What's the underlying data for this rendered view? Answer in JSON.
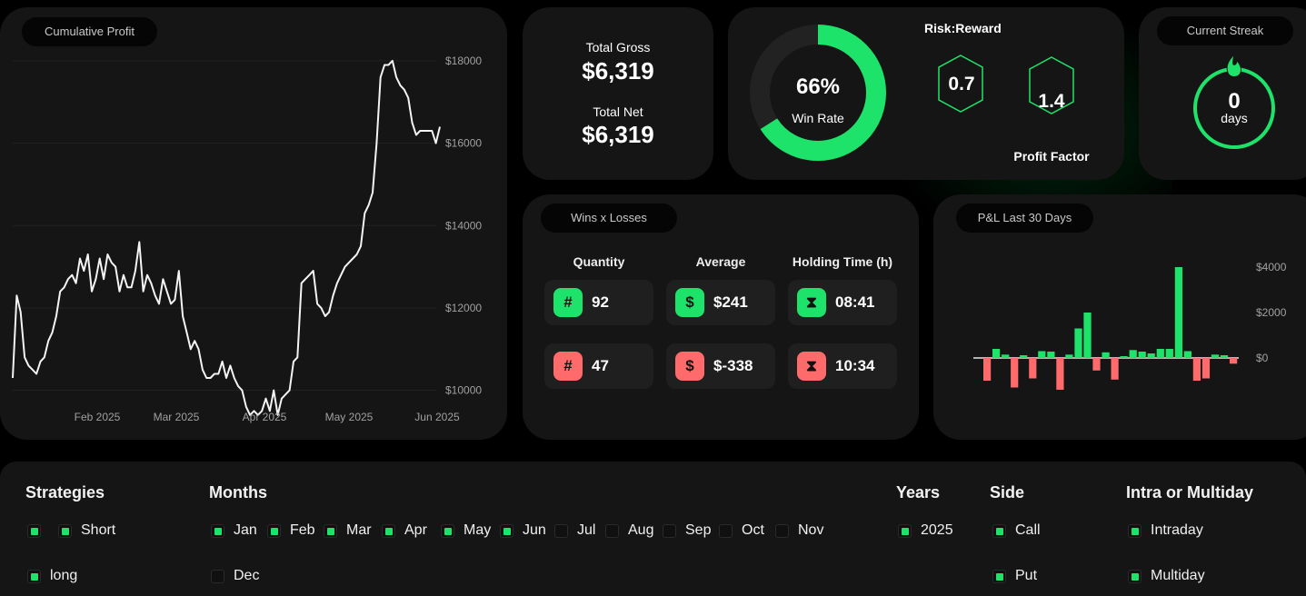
{
  "colors": {
    "accent": "#1ee36a",
    "negative": "#ff6b6b",
    "card": "#151515"
  },
  "cumulative": {
    "title": "Cumulative Profit",
    "chart_data": {
      "type": "line",
      "title": "",
      "y_ticks": [
        "$18000",
        "$16000",
        "$14000",
        "$12000",
        "$10000"
      ],
      "x_ticks": [
        "Feb 2025",
        "Mar 2025",
        "Apr 2025",
        "May 2025",
        "Jun 2025"
      ],
      "ylim": [
        8800,
        19300
      ],
      "grid": true,
      "series": [
        {
          "values": [
            10300,
            12300,
            11900,
            10800,
            10600,
            10500,
            10400,
            10700,
            10800,
            11200,
            11400,
            11800,
            12400,
            12500,
            12700,
            12800,
            12600,
            13200,
            12900,
            13300,
            12400,
            12700,
            13200,
            12700,
            13300,
            13100,
            13000,
            12400,
            12800,
            12500,
            12500,
            12900,
            13600,
            12400,
            12800,
            12600,
            12300,
            12100,
            12700,
            12400,
            12100,
            12200,
            12900,
            11800,
            11400,
            11000,
            11200,
            11000,
            10500,
            10300,
            10300,
            10400,
            10400,
            10700,
            10300,
            10600,
            10300,
            10100,
            10000,
            9600,
            9400,
            9500,
            9400,
            9500,
            9800,
            9500,
            10000,
            9400,
            9800,
            9900,
            10000,
            10700,
            10800,
            12600,
            12700,
            12800,
            12900,
            12100,
            12000,
            11800,
            11900,
            12300,
            12600,
            12800,
            13000,
            13100,
            13200,
            13300,
            13500,
            14300,
            14500,
            14800,
            16000,
            17600,
            17900,
            17900,
            18000,
            17600,
            17400,
            17300,
            17100,
            16500,
            16200,
            16300,
            16300,
            16300,
            16300,
            16000,
            16400
          ]
        }
      ]
    }
  },
  "gross": {
    "label": "Total Gross",
    "value": "$6,319"
  },
  "net": {
    "label": "Total Net",
    "value": "$6,319"
  },
  "winrate": {
    "value": "66%",
    "label": "Win Rate",
    "percent": 66
  },
  "risk": {
    "label": "Risk:Reward",
    "value": "0.7"
  },
  "profit_factor": {
    "label": "Profit Factor",
    "value": "1.4"
  },
  "streak": {
    "label": "Current Streak",
    "value": "0",
    "unit": "days"
  },
  "wins_losses": {
    "title": "Wins x Losses",
    "headers": {
      "quantity": "Quantity",
      "average": "Average",
      "holding": "Holding Time (h)"
    },
    "wins": {
      "quantity": "92",
      "average": "$241",
      "holding": "08:41"
    },
    "losses": {
      "quantity": "47",
      "average": "$-338",
      "holding": "10:34"
    },
    "icons": {
      "hash": "#",
      "dollar": "$",
      "hourglass": "⧗"
    }
  },
  "pnl30": {
    "title": "P&L Last 30 Days",
    "chart_data": {
      "type": "bar",
      "y_ticks": [
        "$4000",
        "$2000",
        "$0"
      ],
      "ylim": [
        -1500,
        4500
      ],
      "values": [
        -1000,
        400,
        150,
        -1300,
        120,
        -900,
        300,
        280,
        -1400,
        150,
        1300,
        2000,
        -550,
        250,
        -950,
        80,
        350,
        280,
        200,
        400,
        400,
        4000,
        300,
        -1000,
        -900,
        150,
        120,
        -250
      ]
    }
  },
  "filters": {
    "strategies": {
      "title": "Strategies",
      "options": [
        {
          "label": "",
          "on": true
        },
        {
          "label": "Short",
          "on": true
        },
        {
          "label": "long",
          "on": true
        }
      ]
    },
    "months": {
      "title": "Months",
      "options": [
        {
          "label": "Jan",
          "on": true
        },
        {
          "label": "Feb",
          "on": true
        },
        {
          "label": "Mar",
          "on": true
        },
        {
          "label": "Apr",
          "on": true
        },
        {
          "label": "May",
          "on": true
        },
        {
          "label": "Jun",
          "on": true
        },
        {
          "label": "Jul",
          "on": false
        },
        {
          "label": "Aug",
          "on": false
        },
        {
          "label": "Sep",
          "on": false
        },
        {
          "label": "Oct",
          "on": false
        },
        {
          "label": "Nov",
          "on": false
        },
        {
          "label": "Dec",
          "on": false
        }
      ]
    },
    "years": {
      "title": "Years",
      "options": [
        {
          "label": "2025",
          "on": true
        }
      ]
    },
    "side": {
      "title": "Side",
      "options": [
        {
          "label": "Call",
          "on": true
        },
        {
          "label": "Put",
          "on": true
        }
      ]
    },
    "intra": {
      "title": "Intra or Multiday",
      "options": [
        {
          "label": "Intraday",
          "on": true
        },
        {
          "label": "Multiday",
          "on": true
        }
      ]
    }
  }
}
